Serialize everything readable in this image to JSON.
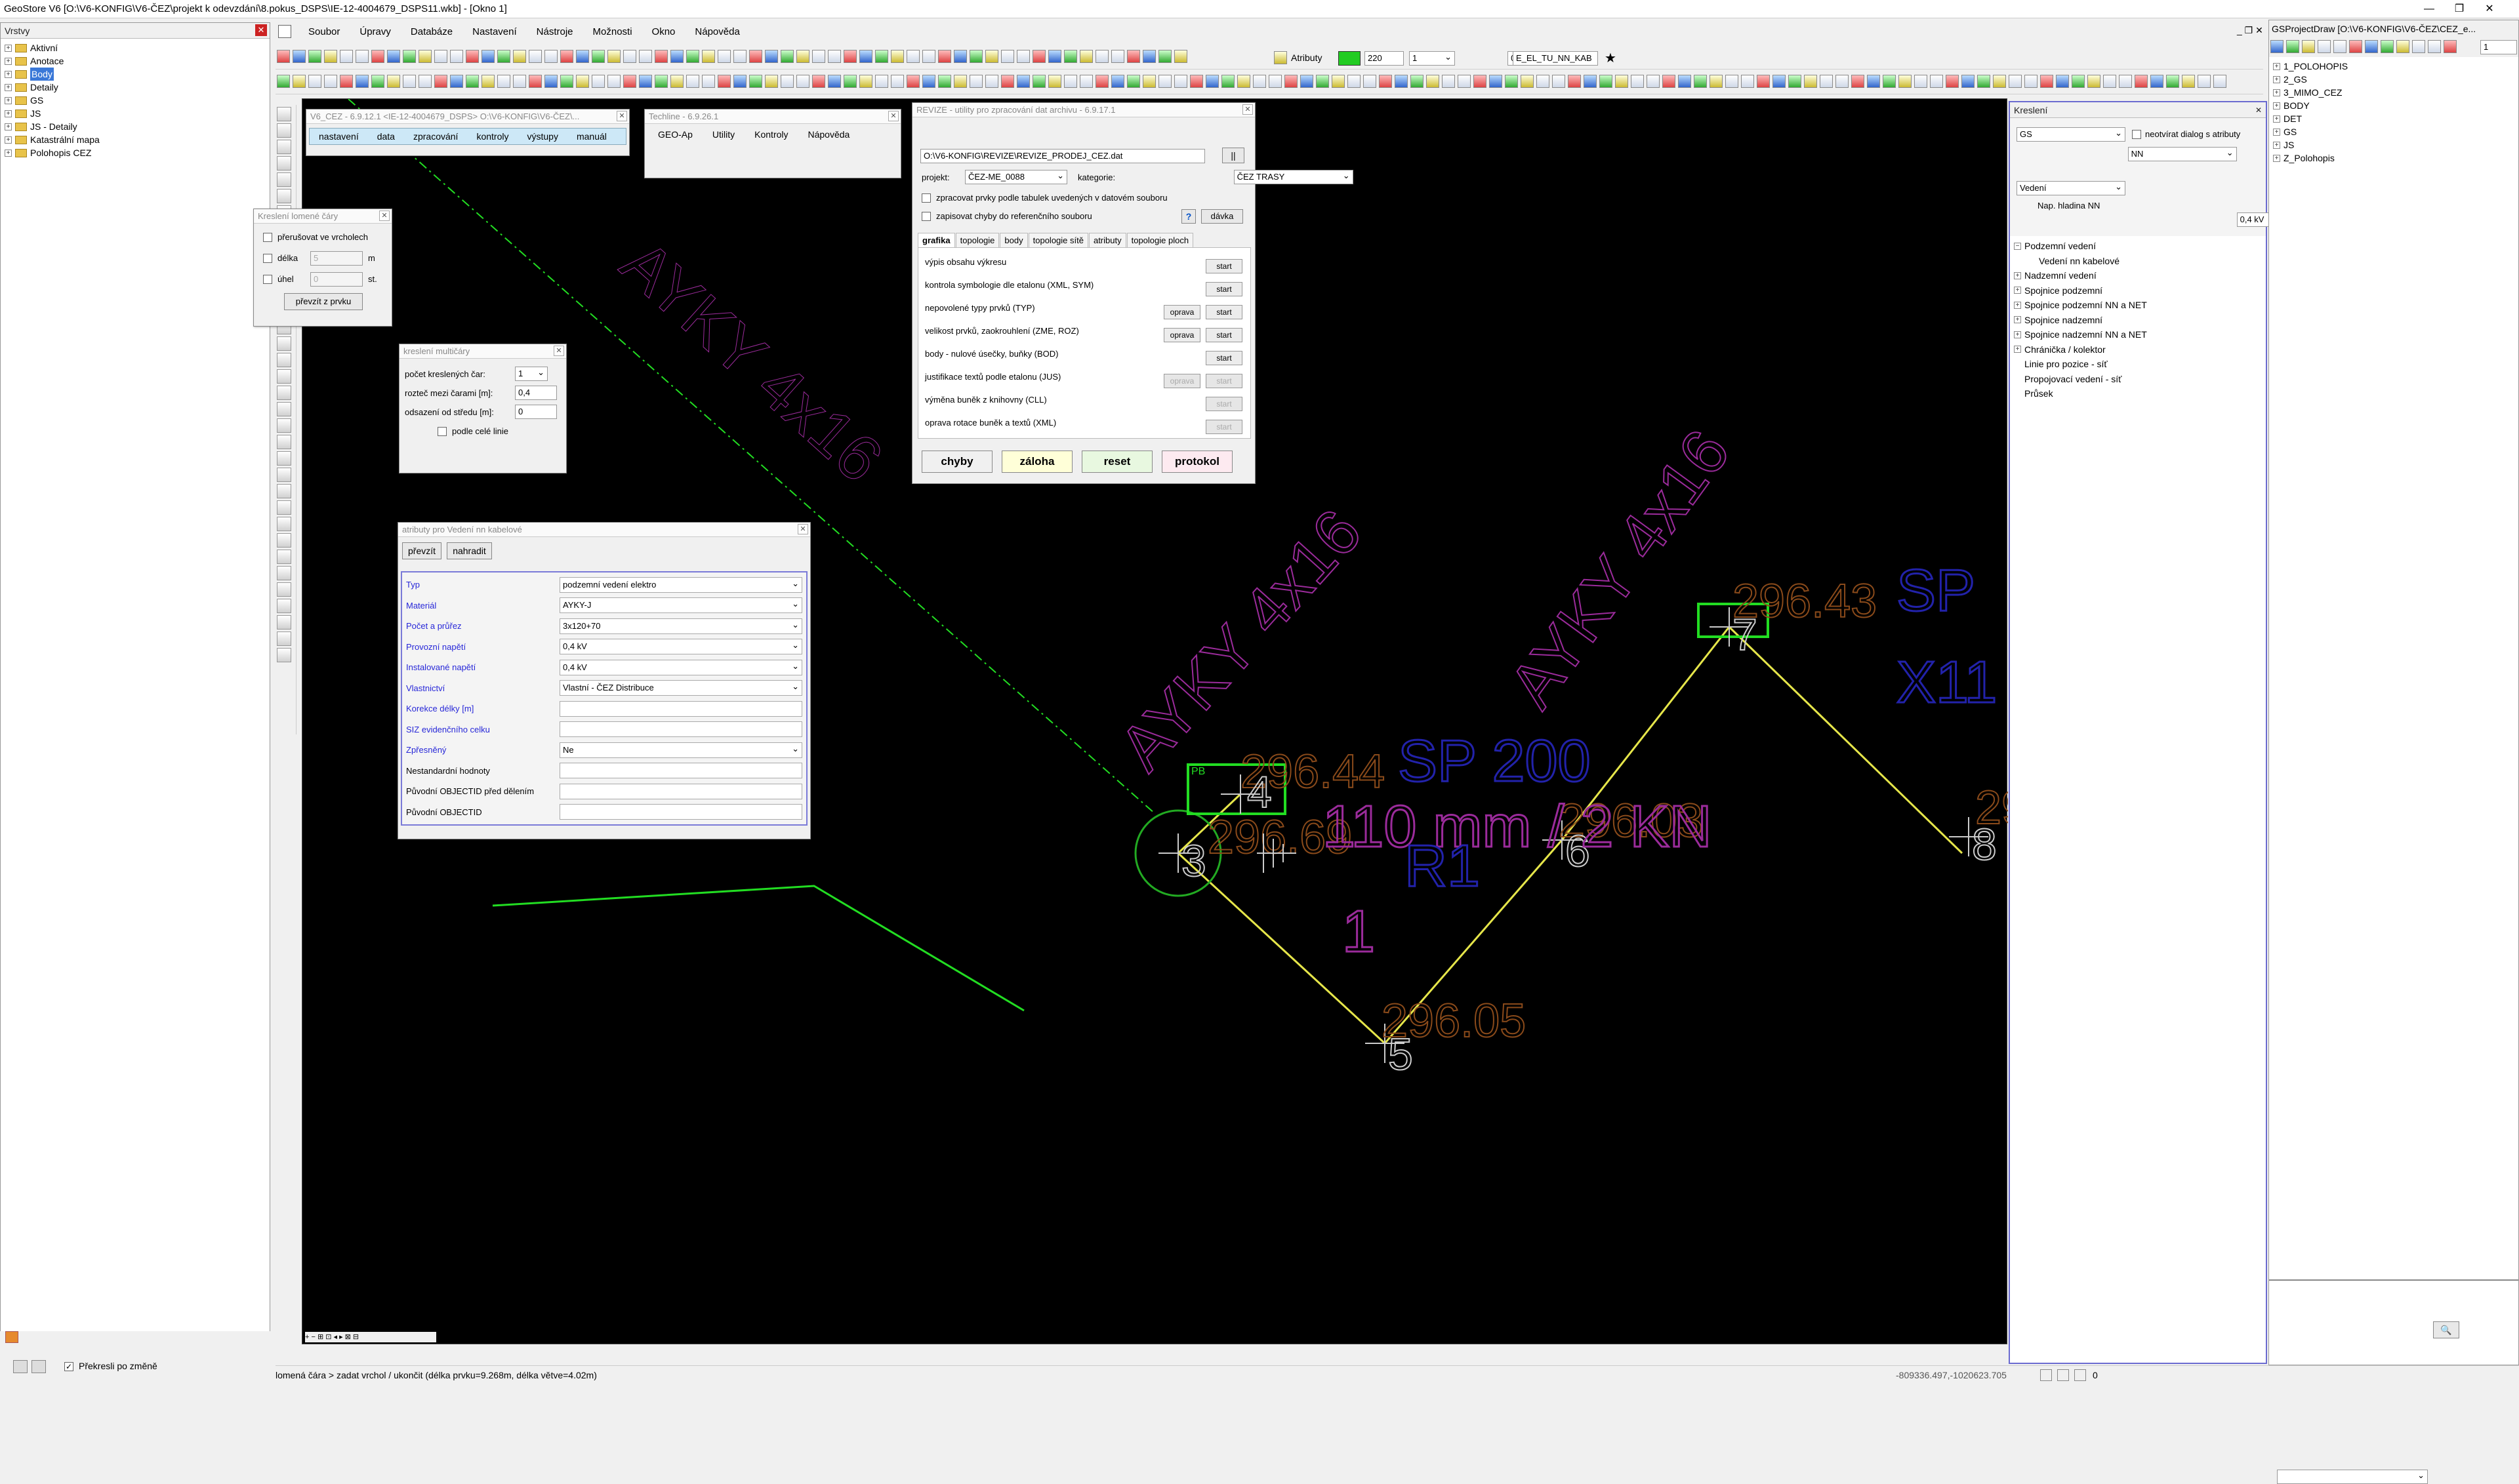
{
  "window_title": "GeoStore V6 [O:\\V6-KONFIG\\V6-ČEZ\\projekt k odevzdání\\8.pokus_DSPS\\IE-12-4004679_DSPS11.wkb] - [Okno 1]",
  "gsproject_title": "GSProjectDraw  [O:\\V6-KONFIG\\V6-ČEZ\\CEZ_e...",
  "menu": [
    "Soubor",
    "Úpravy",
    "Databáze",
    "Nastavení",
    "Nástroje",
    "Možnosti",
    "Okno",
    "Nápověda"
  ],
  "toolbar": {
    "attributes_label": "Atributy",
    "color_value": "220",
    "line_a": "1",
    "line_b": "0",
    "layer_name": "E_EL_TU_NN_KAB"
  },
  "layers_panel": {
    "title": "Vrstvy",
    "items": [
      "Aktivní",
      "Anotace",
      "Body",
      "Detaily",
      "GS",
      "JS",
      "JS - Detaily",
      "Katastrální mapa",
      "Polohopis CEZ"
    ],
    "selected": "Body",
    "redraw_label": "Překresli po změně"
  },
  "v6cez": {
    "title": "V6_CEZ - 6.9.12.1 <IE-12-4004679_DSPS> O:\\V6-KONFIG\\V6-ČEZ\\...",
    "menu": [
      "nastavení",
      "data",
      "zpracování",
      "kontroly",
      "výstupy",
      "manuál"
    ]
  },
  "techline": {
    "title": "Techline - 6.9.26.1",
    "menu": [
      "GEO-Ap",
      "Utility",
      "Kontroly",
      "Nápověda"
    ]
  },
  "kresleni_lomene": {
    "title": "Kreslení lomené čáry",
    "opt1": "přerušovat ve vrcholech",
    "opt2": "délka",
    "opt2_val": "5",
    "opt2_unit": "m",
    "opt3": "úhel",
    "opt3_val": "0",
    "opt3_unit": "st.",
    "button": "převzít z prvku"
  },
  "kresleni_multi": {
    "title": "kreslení multičáry",
    "count_label": "počet kreslených čar:",
    "count_val": "1",
    "spacing_label": "rozteč mezi čarami [m]:",
    "spacing_val": "0,4",
    "offset_label": "odsazení od středu [m]:",
    "offset_val": "0",
    "full_label": "podle celé linie"
  },
  "attr_window": {
    "title": "atributy pro Vedení nn kabelové",
    "btn_take": "převzít",
    "btn_replace": "nahradit",
    "rows": [
      {
        "label": "Typ",
        "value": "podzemní vedení elektro",
        "blue": true,
        "dd": true
      },
      {
        "label": "Materiál",
        "value": "AYKY-J",
        "blue": true,
        "dd": true
      },
      {
        "label": "Počet a průřez",
        "value": "3x120+70",
        "blue": true,
        "dd": true
      },
      {
        "label": "Provozní napětí",
        "value": "0,4 kV",
        "blue": true,
        "dd": true
      },
      {
        "label": "Instalované napětí",
        "value": "0,4 kV",
        "blue": true,
        "dd": true
      },
      {
        "label": "Vlastnictví",
        "value": "Vlastní - ČEZ Distribuce",
        "blue": true,
        "dd": true
      },
      {
        "label": "Korekce délky [m]",
        "value": "",
        "blue": true,
        "dd": false
      },
      {
        "label": "SIZ evidenčního celku",
        "value": "",
        "blue": true,
        "dd": false
      },
      {
        "label": "Zpřesněný",
        "value": "Ne",
        "blue": true,
        "dd": true
      },
      {
        "label": "Nestandardní hodnoty",
        "value": "",
        "blue": false,
        "dd": false
      },
      {
        "label": "Původní OBJECTID před dělením",
        "value": "",
        "blue": false,
        "dd": false
      },
      {
        "label": "Původní OBJECTID",
        "value": "",
        "blue": false,
        "dd": false
      }
    ]
  },
  "revize": {
    "title": "REVIZE - utility pro zpracování dat archivu - 6.9.17.1",
    "path": "O:\\V6-KONFIG\\REVIZE\\REVIZE_PRODEJ_CEZ.dat",
    "project_label": "projekt:",
    "project_val": "ČEZ-ME_0088",
    "category_label": "kategorie:",
    "category_val": "ČEZ TRASY",
    "chk1": "zpracovat prvky podle tabulek uvedených v datovém souboru",
    "chk2": "zapisovat chyby do referenčního souboru",
    "help": "?",
    "batch": "dávka",
    "tabs": [
      "grafika",
      "topologie",
      "body",
      "topologie sítě",
      "atributy",
      "topologie ploch"
    ],
    "rows": [
      {
        "label": "výpis obsahu výkresu",
        "fix": "",
        "start": "start",
        "fix_dis": false,
        "start_dis": false
      },
      {
        "label": "kontrola symbologie dle etalonu (XML, SYM)",
        "fix": "",
        "start": "start",
        "fix_dis": false,
        "start_dis": false
      },
      {
        "label": "nepovolené typy prvků (TYP)",
        "fix": "oprava",
        "start": "start",
        "fix_dis": false,
        "start_dis": false
      },
      {
        "label": "velikost prvků, zaokrouhlení (ZME, ROZ)",
        "fix": "oprava",
        "start": "start",
        "fix_dis": false,
        "start_dis": false
      },
      {
        "label": "body - nulové úsečky, buňky (BOD)",
        "fix": "",
        "start": "start",
        "fix_dis": false,
        "start_dis": false
      },
      {
        "label": "justifikace textů podle etalonu (JUS)",
        "fix": "oprava",
        "start": "start",
        "fix_dis": true,
        "start_dis": true
      },
      {
        "label": "výměna buněk z knihovny (CLL)",
        "fix": "",
        "start": "start",
        "fix_dis": false,
        "start_dis": true
      },
      {
        "label": "oprava rotace buněk a textů (XML)",
        "fix": "",
        "start": "start",
        "fix_dis": false,
        "start_dis": true
      }
    ],
    "bottom": [
      "chyby",
      "záloha",
      "reset",
      "protokol"
    ]
  },
  "kresleni_panel": {
    "title": "Kreslení",
    "sel1": "GS",
    "sel2": "NN",
    "sel3": "Vedení",
    "chk": "neotvírat dialog s atributy",
    "nap_label": "Nap. hladina NN",
    "nap_val": "0,4 kV",
    "tree": [
      {
        "label": "Podzemní vedení",
        "level": 0,
        "pm": "−"
      },
      {
        "label": "Vedení nn kabelové",
        "level": 1,
        "pm": ""
      },
      {
        "label": "Nadzemní vedení",
        "level": 0,
        "pm": "+"
      },
      {
        "label": "Spojnice podzemní",
        "level": 0,
        "pm": "+"
      },
      {
        "label": "Spojnice podzemní NN a NET",
        "level": 0,
        "pm": "+"
      },
      {
        "label": "Spojnice nadzemní",
        "level": 0,
        "pm": "+"
      },
      {
        "label": "Spojnice nadzemní NN a NET",
        "level": 0,
        "pm": "+"
      },
      {
        "label": "Chránička / kolektor",
        "level": 0,
        "pm": "+"
      },
      {
        "label": "Linie pro pozice - síť",
        "level": 0,
        "pm": ""
      },
      {
        "label": "Propojovací vedení - síť",
        "level": 0,
        "pm": ""
      },
      {
        "label": "Průsek",
        "level": 0,
        "pm": ""
      }
    ]
  },
  "gsproject_tree": [
    "1_POLOHOPIS",
    "2_GS",
    "3_MIMO_CEZ",
    "BODY",
    "DET",
    "GS",
    "JS",
    "Z_Polohopis"
  ],
  "gsproject_num": "1",
  "canvas_labels": {
    "cable1": "AYKY 4x16",
    "cable2": "AYKY 4x16",
    "cable3": "AYKY 4x16",
    "h1": "296.44",
    "h2": "296.69",
    "h3": "296.03",
    "h4": "296.05",
    "h5": "296.43",
    "h6": "29",
    "n3": "3",
    "n4": "4",
    "n5": "5",
    "n6": "6",
    "n7": "7",
    "n8": "8",
    "sp200": "SP 200",
    "dim": "110 mm / 2 KN",
    "r1": "R1",
    "one": "1",
    "sp": "SP",
    "x11": "X11",
    "pb": "PB"
  },
  "status": {
    "text": "lomená čára > zadat vrchol / ukončit (délka prvku=9.268m, délka větve=4.02m)",
    "coords": "-809336.497,-1020623.705",
    "zero": "0"
  },
  "colors": {
    "canvas_bg": "#000000",
    "cable_label": "#9b2b9b",
    "height_label": "#8a4a1a",
    "line_yellow": "#e6e64a",
    "line_green": "#22dd22",
    "sp_blue": "#2222aa"
  }
}
